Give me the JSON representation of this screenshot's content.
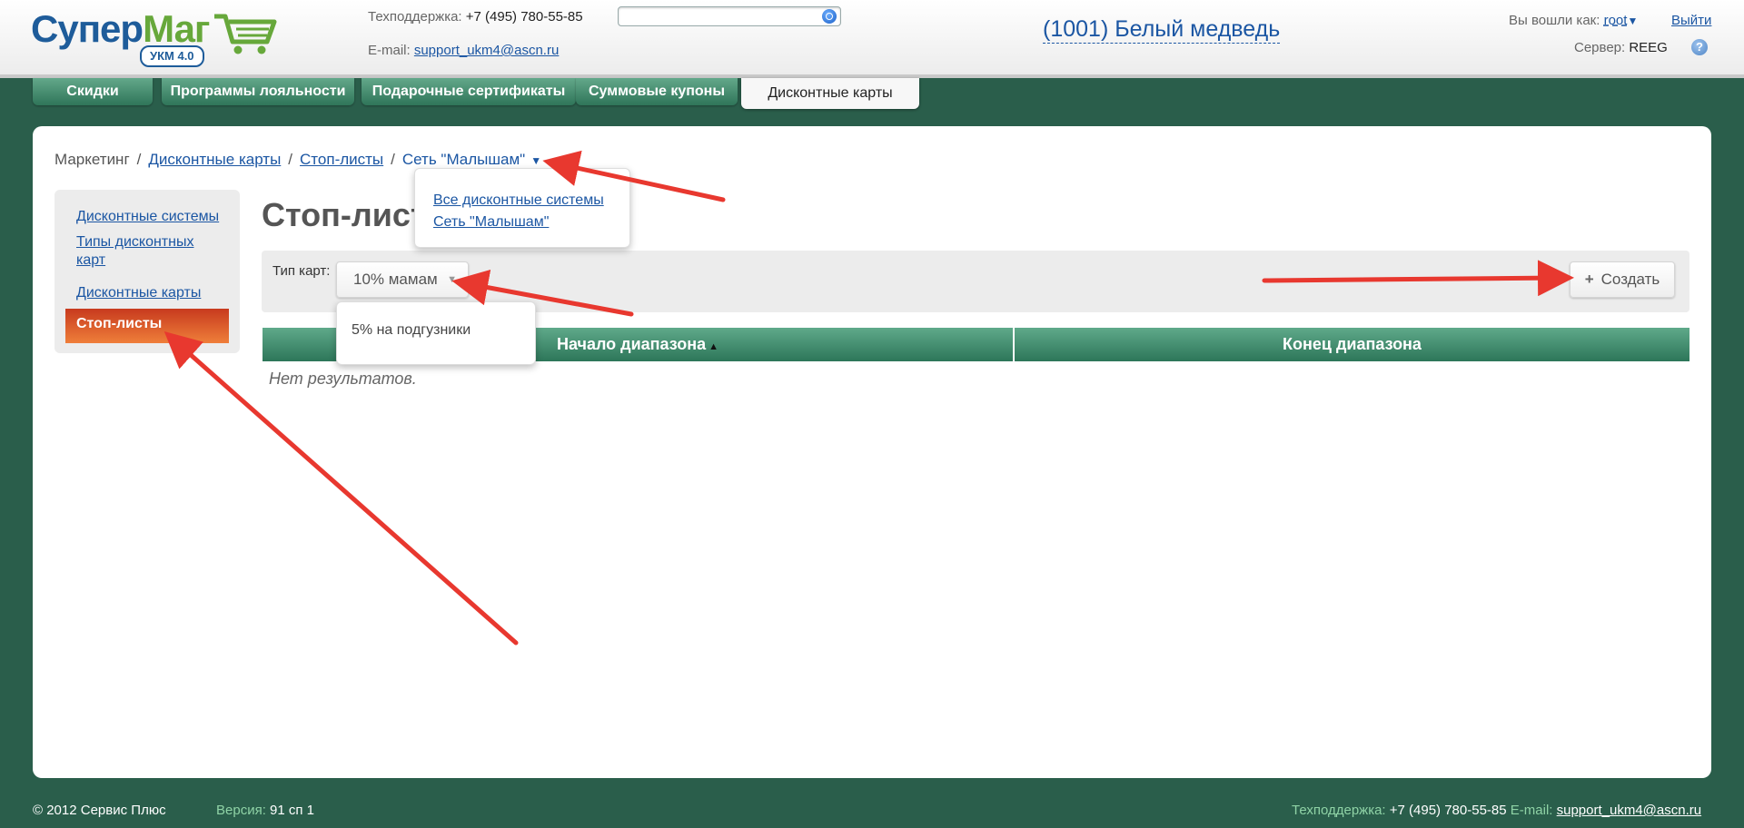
{
  "header": {
    "logo": {
      "word1": "Супер",
      "word2": "Маг",
      "badge": "УКМ 4.0"
    },
    "support_label": "Техподдержка:",
    "support_phone": "+7 (495) 780-55-85",
    "email_label": "E-mail:",
    "email": "support_ukm4@ascn.ru",
    "search_value": "",
    "store": "(1001) Белый медведь",
    "logged_in_label": "Вы вошли как:",
    "user": "root",
    "logout": "Выйти",
    "server_label": "Сервер:",
    "server": "REEG"
  },
  "tabs": [
    {
      "label": "Скидки"
    },
    {
      "label": "Программы лояльности"
    },
    {
      "label": "Подарочные сертификаты"
    },
    {
      "label": "Суммовые купоны"
    },
    {
      "label": "Дисконтные карты",
      "active": true
    }
  ],
  "breadcrumb": {
    "root": "Маркетинг",
    "items": [
      "Дисконтные карты",
      "Стоп-листы"
    ],
    "current": "Сеть \"Малышам\"",
    "dropdown": [
      "Все дисконтные системы",
      "Сеть \"Малышам\""
    ]
  },
  "sidebar": {
    "items": [
      "Дисконтные системы",
      "Типы дисконтных карт",
      "Дисконтные карты"
    ],
    "active": "Стоп-листы"
  },
  "page_title": "Стоп-листы",
  "toolbar": {
    "type_label": "Тип карт:",
    "type_value": "10% мамам",
    "type_options": [
      "5% на подгузники"
    ],
    "create_label": "Создать"
  },
  "table": {
    "columns": [
      "Начало диапазона",
      "Конец диапазона"
    ],
    "empty": "Нет результатов."
  },
  "footer": {
    "copyright": "© 2012 Сервис Плюс",
    "version_label": "Версия:",
    "version": "91 сп 1",
    "support_label": "Техподдержка:",
    "support_phone": "+7 (495) 780-55-85",
    "email_label": "E-mail:",
    "email": "support_ukm4@ascn.ru"
  },
  "colors": {
    "brand_green": "#2a5e4b",
    "tab_green": "#4f9276",
    "link": "#1b56a3",
    "active_orange": "#e06a2f",
    "arrow_red": "#e8382f"
  }
}
